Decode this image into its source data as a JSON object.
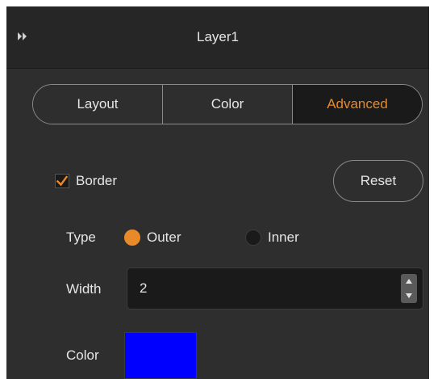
{
  "panel": {
    "title": "Layer1",
    "collapse_icon": "double-chevron-right-icon"
  },
  "tabs": [
    {
      "label": "Layout",
      "active": false
    },
    {
      "label": "Color",
      "active": false
    },
    {
      "label": "Advanced",
      "active": true
    }
  ],
  "border": {
    "label": "Border",
    "checked": true
  },
  "reset_label": "Reset",
  "type": {
    "label": "Type",
    "options": [
      {
        "label": "Outer",
        "selected": true
      },
      {
        "label": "Inner",
        "selected": false
      }
    ]
  },
  "width": {
    "label": "Width",
    "value": "2"
  },
  "color": {
    "label": "Color",
    "swatch": "#0000ff"
  },
  "theme": {
    "accent": "#e8892a",
    "panel_bg": "#2e2e2e",
    "field_bg": "#1a1a1a",
    "text": "#e6e6e6"
  }
}
